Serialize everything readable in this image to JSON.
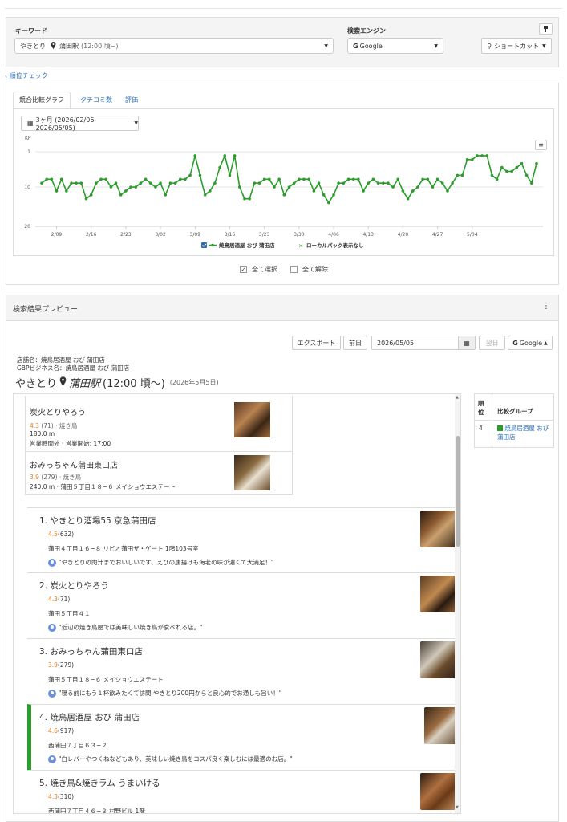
{
  "search": {
    "keyword_label": "キーワード",
    "keyword_value_a": "やきとり",
    "keyword_value_b": "蒲田駅",
    "keyword_value_c": "(12:00 頃~)",
    "engine_label": "検索エンジン",
    "engine_value": "Google",
    "shortcut_label": "ショートカット"
  },
  "back_link": "順位チェック",
  "tabs": [
    "競合比較グラフ",
    "クチコミ数",
    "評価"
  ],
  "range_label": "3ヶ月 (2026/02/06-2026/05/05)",
  "chart_data": {
    "type": "line",
    "ylabel": "KP",
    "yticks": [
      "1",
      "10",
      "20"
    ],
    "ylim": [
      1,
      20
    ],
    "xlabels": [
      "2/09",
      "2/16",
      "2/23",
      "3/02",
      "3/09",
      "3/16",
      "3/23",
      "3/30",
      "4/06",
      "4/13",
      "4/20",
      "4/27",
      "5/04"
    ],
    "series": [
      {
        "name": "焼鳥居酒屋 おび 蒲田店",
        "color": "#2a9d2a",
        "values": [
          9,
          8,
          8,
          11,
          8,
          11,
          9,
          9,
          9,
          13,
          12,
          9,
          8,
          8,
          10,
          9,
          12,
          11,
          10,
          10,
          9,
          8,
          9,
          10,
          9,
          12,
          9,
          9,
          8,
          8,
          7,
          2,
          7,
          12,
          11,
          9,
          5,
          2,
          7,
          2,
          10,
          13,
          13,
          9,
          9,
          8,
          8,
          10,
          8,
          12,
          10,
          9,
          8,
          8,
          8,
          11,
          9,
          12,
          14,
          12,
          9,
          9,
          8,
          8,
          8,
          11,
          9,
          8,
          9,
          9,
          9,
          10,
          8,
          11,
          13,
          11,
          10,
          8,
          8,
          10,
          8,
          9,
          11,
          9,
          7,
          7,
          3,
          3,
          2,
          2,
          2,
          7,
          8,
          5,
          6,
          6,
          5,
          4,
          7,
          9,
          4
        ]
      }
    ],
    "legend": [
      {
        "label": "焼鳥居酒屋 おび 蒲田店",
        "checked": true
      },
      {
        "label": "ローカルパック表示なし",
        "checked": false
      }
    ]
  },
  "select_all": "全て選択",
  "deselect_all": "全て解除",
  "preview": {
    "title": "検索結果プレビュー",
    "export": "エクスポート",
    "prev": "前日",
    "date": "2026/05/05",
    "next": "翌日",
    "engine": "Google",
    "store_name": "店舗名：焼鳥居酒屋 おび 蒲田店",
    "gbp_name": "GBPビジネス名：焼鳥居酒屋 おび 蒲田店",
    "heading_kw": "やきとり",
    "heading_station": "蒲田駅",
    "heading_time": "(12:00 頃〜)",
    "heading_date": "(2026年5月5日)"
  },
  "local_pack": [
    {
      "name": "炭火とりやろう",
      "rating": "4.3",
      "rest": "(71) · 焼き鳥",
      "line2": "180.0 m",
      "line3": "営業時間外 · 営業開始: 17:00"
    },
    {
      "name": "おみっちゃん蒲田東口店",
      "rating": "3.9",
      "rest": "(279) · 焼き鳥",
      "line2": "240.0 m · 蒲田５丁目１８−６ メイショウエステート",
      "line3": ""
    }
  ],
  "results": [
    {
      "title": "1. やきとり酒場55 京急蒲田店",
      "rating": "4.5",
      "count": "(632)",
      "address": "蒲田４丁目１６−８ リビオ蒲田ザ・ゲート 1階103号室",
      "review": "\"やきとりの肉汁までおいしいです、えびの唐揚げも海老の味が濃くて大満足！\""
    },
    {
      "title": "2. 炭火とりやろう",
      "rating": "4.3",
      "count": "(71)",
      "address": "蒲田５丁目４１",
      "review": "\"近辺の焼き鳥屋では美味しい焼き鳥が食べれる店。\""
    },
    {
      "title": "3. おみっちゃん蒲田東口店",
      "rating": "3.9",
      "count": "(279)",
      "address": "蒲田５丁目１８−６ メイショウエステート",
      "review": "\"寝る前にもう１杯飲みたくて訪問 やきとり200円からと良心的でお通しも旨い！\""
    },
    {
      "title": "4. 焼鳥居酒屋 おび 蒲田店",
      "rating": "4.6",
      "count": "(917)",
      "address": "西蒲田７丁目６３−２",
      "review": "\"白レバーやつくねなどもあり、美味しい焼き鳥をコスパ良く楽しむには最適のお店。\""
    },
    {
      "title": "5. 焼き鳥&焼きラム うまいける",
      "rating": "4.3",
      "count": "(310)",
      "address": "西蒲田７丁目４６−３ 村野ビル 1階",
      "review": ""
    }
  ],
  "side_table": {
    "col1": "順位",
    "col2": "比較グループ",
    "rank": "4",
    "group": "焼鳥居酒屋 おび 蒲田店",
    "color": "#2a9d2a"
  },
  "colors": {
    "accent": "#2a6ebb",
    "series": "#2a9d2a",
    "rating": "#e07b1a",
    "highlight": "#2a9d2a"
  }
}
